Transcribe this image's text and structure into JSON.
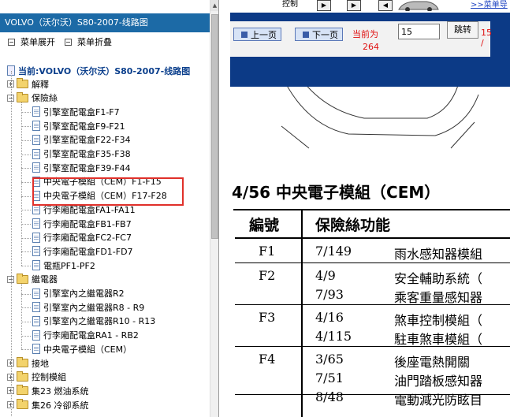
{
  "sidebar": {
    "title": "VOLVO（沃尔沃）S80-2007-线路图",
    "expand_label": "菜单展开",
    "collapse_label": "菜单折叠",
    "root_label": "当前:VOLVO（沃尔沃）S80-2007-线路图",
    "tree": [
      {
        "label": "解釋",
        "type": "folder",
        "expanded": false
      },
      {
        "label": "保險絲",
        "type": "folder",
        "expanded": true
      },
      {
        "label": "引擎室配電盒F1-F7",
        "type": "page"
      },
      {
        "label": "引擎室配電盒F9-F21",
        "type": "page"
      },
      {
        "label": "引擎室配電盒F22-F34",
        "type": "page"
      },
      {
        "label": "引擎室配電盒F35-F38",
        "type": "page"
      },
      {
        "label": "引擎室配電盒F39-F44",
        "type": "page"
      },
      {
        "label": "中央電子模組（CEM）F1-F15",
        "type": "page",
        "selected": true
      },
      {
        "label": "中央電子模組（CEM）F17-F28",
        "type": "page",
        "selected": true
      },
      {
        "label": "行李廂配電盒FA1-FA11",
        "type": "page"
      },
      {
        "label": "行李廂配電盒FB1-FB7",
        "type": "page"
      },
      {
        "label": "行李廂配電盒FC2-FC7",
        "type": "page"
      },
      {
        "label": "行李廂配電盒FD1-FD7",
        "type": "page"
      },
      {
        "label": "電瓶PF1-PF2",
        "type": "page"
      },
      {
        "label": "繼電器",
        "type": "folder",
        "expanded": true
      },
      {
        "label": "引擎室內之繼電器R2",
        "type": "page"
      },
      {
        "label": "引擎室內之繼電器R8 - R9",
        "type": "page"
      },
      {
        "label": "引擎室內之繼電器R10 - R13",
        "type": "page"
      },
      {
        "label": "行李廂配電盒RA1 - RB2",
        "type": "page"
      },
      {
        "label": "中央電子模組（CEM）",
        "type": "page"
      },
      {
        "label": "接地",
        "type": "folder",
        "expanded": false
      },
      {
        "label": "控制模組",
        "type": "folder",
        "expanded": false
      },
      {
        "label": "集23 燃油系统",
        "type": "folder",
        "expanded": false
      },
      {
        "label": "集26 冷卻系統",
        "type": "folder",
        "expanded": false
      }
    ]
  },
  "topbar": {
    "partial_text": "控制",
    "link_label": ">>菜单导"
  },
  "nav": {
    "prev_label": "上一页",
    "next_label": "下一页",
    "current_label": "当前为",
    "page_value": "15",
    "jump_label": "跳转",
    "count_a": "15 /",
    "count_b": "264"
  },
  "document": {
    "title": "4/56 中央電子模組（CEM）",
    "header_col1": "編號",
    "header_col2": "保險絲功能",
    "rows": [
      {
        "id": "F1",
        "refs": [
          "7/149"
        ],
        "funcs": [
          "雨水感知器模組"
        ]
      },
      {
        "id": "F2",
        "refs": [
          "4/9",
          "7/93"
        ],
        "funcs": [
          "安全輔助系統（",
          "乘客重量感知器"
        ]
      },
      {
        "id": "F3",
        "refs": [
          "4/16",
          "4/115"
        ],
        "funcs": [
          "煞車控制模組（",
          "駐車煞車模組（"
        ]
      },
      {
        "id": "F4",
        "refs": [
          "3/65",
          "7/51",
          "8/48"
        ],
        "funcs": [
          "後座電熱開關",
          "油門踏板感知器",
          "電動減光防眩目"
        ]
      }
    ]
  },
  "colors": {
    "sidebar_header": "#1c6aa6",
    "viewer_bg": "#0c3a86",
    "highlight_box": "#e0302a",
    "alert_text": "#e01010"
  }
}
